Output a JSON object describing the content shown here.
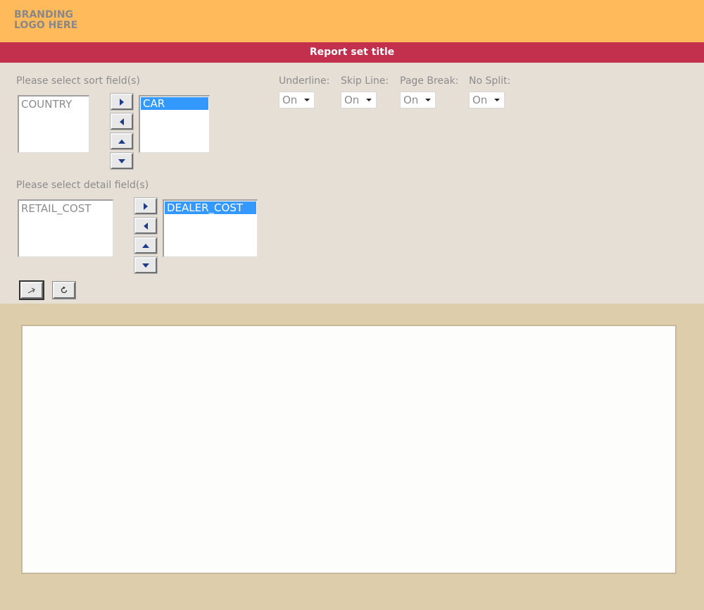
{
  "branding": {
    "line1": "BRANDING",
    "line2": "LOGO HERE"
  },
  "title": "Report set title",
  "sort_section": {
    "label": "Please select sort field(s)",
    "available": [
      "COUNTRY"
    ],
    "selected": [
      "CAR"
    ]
  },
  "detail_section": {
    "label": "Please select detail field(s)",
    "available": [
      "RETAIL_COST"
    ],
    "selected": [
      "DEALER_COST"
    ]
  },
  "options": [
    {
      "label": "Underline:",
      "value": "On"
    },
    {
      "label": "Skip Line:",
      "value": "On"
    },
    {
      "label": "Page Break:",
      "value": "On"
    },
    {
      "label": "No Split:",
      "value": "On"
    }
  ],
  "icons": {
    "move_right": "chevron-right-icon",
    "move_left": "chevron-left-icon",
    "move_up": "arrow-up-icon",
    "move_down": "arrow-down-icon",
    "run": "run-icon",
    "reset": "reset-icon"
  },
  "colors": {
    "brand_bar": "#ffba5c",
    "title_bar": "#c2304d",
    "panel": "#e6dfd6",
    "page_bg": "#ddcdab",
    "selection": "#3399ff"
  }
}
